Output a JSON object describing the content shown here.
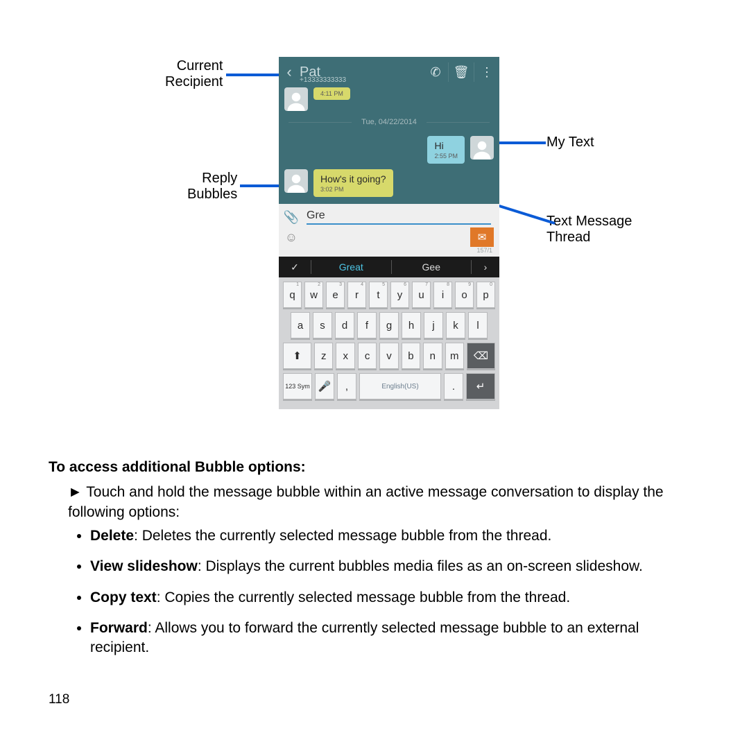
{
  "labels": {
    "current_recipient_l1": "Current",
    "current_recipient_l2": "Recipient",
    "reply_l1": "Reply",
    "reply_l2": "Bubbles",
    "mytext": "My Text",
    "thread_l1": "Text Message",
    "thread_l2": "Thread"
  },
  "phone": {
    "name": "Pat",
    "number": "+13333333333",
    "partial_time": "4:11 PM",
    "date": "Tue, 04/22/2014",
    "msg1": "Hi",
    "msg1_time": "2:55 PM",
    "msg2": "How's it going?",
    "msg2_time": "3:02 PM",
    "input": "Gre",
    "count": "157/1",
    "sug1": "Great",
    "sug2": "Gee",
    "sym": "123\nSym",
    "space": "English(US)"
  },
  "kbd": {
    "r1": [
      "q",
      "w",
      "e",
      "r",
      "t",
      "y",
      "u",
      "i",
      "o",
      "p"
    ],
    "r1n": [
      "1",
      "2",
      "3",
      "4",
      "5",
      "6",
      "7",
      "8",
      "9",
      "0"
    ],
    "r2": [
      "a",
      "s",
      "d",
      "f",
      "g",
      "h",
      "j",
      "k",
      "l"
    ],
    "r3": [
      "z",
      "x",
      "c",
      "v",
      "b",
      "n",
      "m"
    ]
  },
  "text": {
    "heading": "To access additional Bubble options:",
    "lead_pre": "►",
    "lead": "Touch and hold the message bubble within an active message conversation to display the following options:",
    "b1t": "Delete",
    "b1": ": Deletes the currently selected message bubble from the thread.",
    "b2t": "View slideshow",
    "b2": ": Displays the current bubbles media files as an on-screen slideshow.",
    "b3t": "Copy text",
    "b3": ": Copies the currently selected message bubble from the thread.",
    "b4t": "Forward",
    "b4": ": Allows you to forward the currently selected message bubble to an external recipient."
  },
  "pagenum": "118"
}
